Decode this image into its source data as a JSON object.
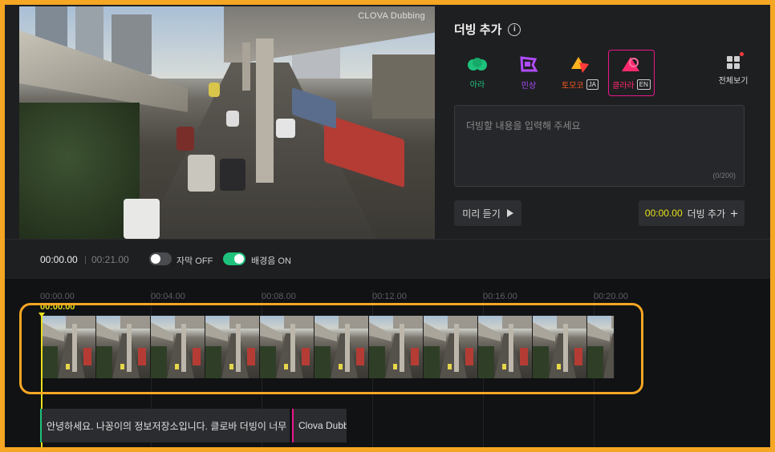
{
  "video": {
    "watermark": "CLOVA Dubbing"
  },
  "panel": {
    "title": "더빙 추가",
    "voices": [
      {
        "name": "아라",
        "icon": "green-cloud-icon",
        "color": "#1ec27c",
        "selected": false
      },
      {
        "name": "민상",
        "icon": "purple-flag-icon",
        "color": "#b04cff",
        "selected": false
      },
      {
        "name": "토모코",
        "icon": "orange-triangle-icon",
        "color": "#ff5a1f",
        "lang": "JA",
        "selected": false
      },
      {
        "name": "클라라",
        "icon": "pink-triangle-icon",
        "color": "#ff2a6d",
        "lang": "EN",
        "selected": true
      }
    ],
    "view_all_label": "전체보기",
    "input_placeholder": "더빙할 내용을 입력해 주세요",
    "char_count": "(0/200)",
    "preview_label": "미리 듣기",
    "add_time": "00:00.00",
    "add_label": "더빙 추가"
  },
  "controls": {
    "current_time": "00:00.00",
    "total_time": "00:21.00",
    "subtitle_label": "자막 OFF",
    "bgm_label": "배경음 ON"
  },
  "timeline": {
    "ticks": [
      "00:00.00",
      "00:04.00",
      "00:08.00",
      "00:12.00",
      "00:16.00",
      "00:20.00"
    ],
    "playhead_time": "00:00.00",
    "clips": [
      {
        "text": "안녕하세요. 나꽁이의 정보저장소입니다. 클로바 더빙이 너무 유용합"
      },
      {
        "text": "Clova Dubbi"
      }
    ]
  }
}
